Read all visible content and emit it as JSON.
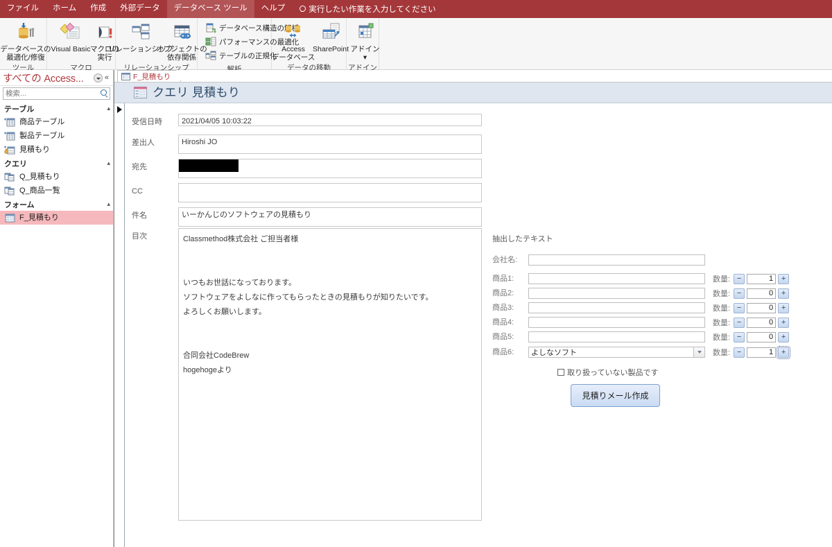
{
  "ribbon": {
    "tabs": [
      {
        "label": "ファイル",
        "active": false
      },
      {
        "label": "ホーム",
        "active": false
      },
      {
        "label": "作成",
        "active": false
      },
      {
        "label": "外部データ",
        "active": false
      },
      {
        "label": "データベース ツール",
        "active": true
      },
      {
        "label": "ヘルプ",
        "active": false
      }
    ],
    "tellme": "実行したい作業を入力してください",
    "groups": [
      {
        "name": "ツール",
        "buttons": [
          {
            "label": "データベースの\n最適化/修復",
            "icon": "database-compact-icon"
          }
        ]
      },
      {
        "name": "マクロ",
        "buttons": [
          {
            "label": "Visual Basic",
            "icon": "visual-basic-icon"
          },
          {
            "label": "マクロの\n実行",
            "icon": "run-macro-icon"
          }
        ]
      },
      {
        "name": "リレーションシップ",
        "buttons": [
          {
            "label": "リレーションシップ",
            "icon": "relationships-icon"
          },
          {
            "label": "オブジェクトの\n依存関係",
            "icon": "object-dependencies-icon"
          }
        ]
      },
      {
        "name": "解析",
        "small_buttons": [
          {
            "label": "データベース構造の解析",
            "icon": "analyze-database-icon"
          },
          {
            "label": "パフォーマンスの最適化",
            "icon": "analyze-performance-icon"
          },
          {
            "label": "テーブルの正規化",
            "icon": "analyze-table-icon"
          }
        ]
      },
      {
        "name": "データの移動",
        "buttons": [
          {
            "label": "Access\nデータベース",
            "icon": "access-database-icon"
          },
          {
            "label": "SharePoint",
            "icon": "sharepoint-icon"
          }
        ]
      },
      {
        "name": "アドイン",
        "buttons": [
          {
            "label": "アドイン\n▾",
            "icon": "addins-icon"
          }
        ]
      }
    ]
  },
  "navpane": {
    "title": "すべての Access...",
    "search_placeholder": "検索...",
    "groups": [
      {
        "label": "テーブル",
        "items": [
          {
            "label": "商品テーブル",
            "icon": "table-icon",
            "selected": false
          },
          {
            "label": "製品テーブル",
            "icon": "table-icon",
            "selected": false
          },
          {
            "label": "見積もり",
            "icon": "linked-table-icon",
            "selected": false
          }
        ]
      },
      {
        "label": "クエリ",
        "items": [
          {
            "label": "Q_見積もり",
            "icon": "query-icon",
            "selected": false
          },
          {
            "label": "Q_商品一覧",
            "icon": "query-icon",
            "selected": false
          }
        ]
      },
      {
        "label": "フォーム",
        "items": [
          {
            "label": "F_見積もり",
            "icon": "form-icon",
            "selected": true
          }
        ]
      }
    ]
  },
  "document": {
    "tab_label": "F_見積もり",
    "form_title": "クエリ 見積もり"
  },
  "mail_form": {
    "fields": [
      {
        "label": "受信日時",
        "value": "2021/04/05 10:03:22",
        "redacted": false
      },
      {
        "label": "差出人",
        "value": "Hiroshi JO",
        "redacted": false
      },
      {
        "label": "宛先",
        "value": "",
        "redacted": true
      },
      {
        "label": "CC",
        "value": "",
        "redacted": false
      },
      {
        "label": "件名",
        "value": "いーかんじのソフトウェアの見積もり",
        "redacted": false
      }
    ],
    "body_label": "目次",
    "body_value": "Classmethod株式会社 ご担当者様\n\n\nいつもお世話になっております。\nソフトウェアをよしなに作ってもらったときの見積もりが知りたいです。\nよろしくお願いします。\n\n\n合同会社CodeBrew\nhogehogeより"
  },
  "extract_panel": {
    "title": "抽出したテキスト",
    "company_label": "会社名:",
    "company_value": "",
    "qty_label": "数量:",
    "minus_label": "−",
    "plus_label": "+",
    "products": [
      {
        "label": "商品1:",
        "value": "",
        "qty": "1",
        "is_combo": false,
        "focused": false
      },
      {
        "label": "商品2:",
        "value": "",
        "qty": "0",
        "is_combo": false,
        "focused": false
      },
      {
        "label": "商品3:",
        "value": "",
        "qty": "0",
        "is_combo": false,
        "focused": false
      },
      {
        "label": "商品4:",
        "value": "",
        "qty": "0",
        "is_combo": false,
        "focused": false
      },
      {
        "label": "商品5:",
        "value": "",
        "qty": "0",
        "is_combo": false,
        "focused": false
      },
      {
        "label": "商品6:",
        "value": "よしなソフト",
        "qty": "1",
        "is_combo": true,
        "focused": true
      }
    ],
    "checkbox_label": "取り扱っていない製品です",
    "checkbox_checked": false,
    "submit_label": "見積りメール作成"
  },
  "colors": {
    "ribbon_red": "#a4373a",
    "active_tab_red": "#b35457",
    "nav_title_red": "#b03a3e",
    "selection_pink": "#f5b8bc",
    "form_header_blue": "#dfe6ef",
    "form_title_blue": "#2d4a6b",
    "button_blue": "#c9dbf2"
  }
}
